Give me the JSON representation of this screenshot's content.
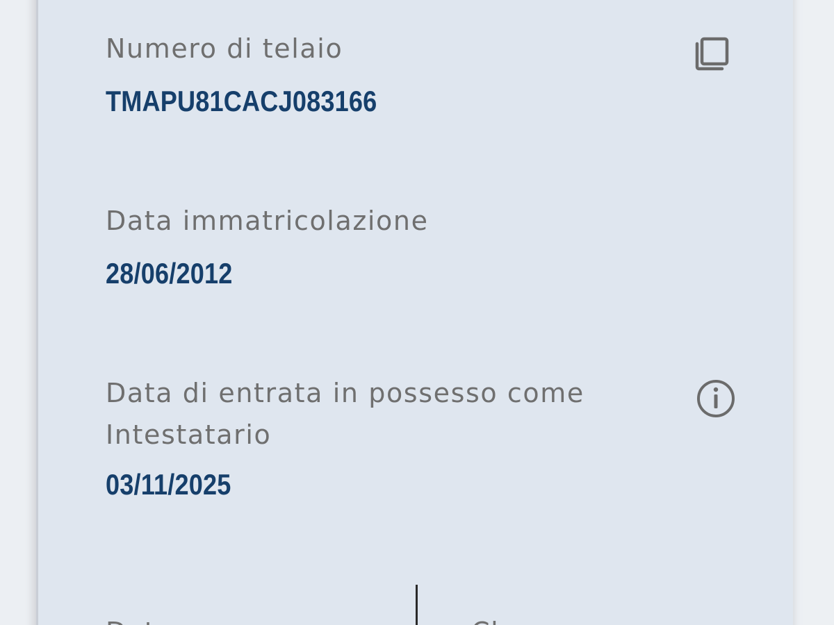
{
  "vehicle": {
    "chassis_number": {
      "label": "Numero di telaio",
      "value": "TMAPU81CACJ083166",
      "action_icon": "copy-icon"
    },
    "registration_date": {
      "label": "Data immatricolazione",
      "value": "28/06/2012"
    },
    "possession_date": {
      "label": "Data di entrata in possesso come Intestatario",
      "value": "03/11/2025",
      "info_icon": "info-icon"
    },
    "next_row": {
      "left_label": "Data",
      "right_label": "Classe"
    }
  },
  "colors": {
    "card_background": "#dfe6ef",
    "page_background": "#eceff3",
    "label_text": "#6f6f6f",
    "value_text": "#163f6b",
    "icon": "#6b6b6b"
  }
}
